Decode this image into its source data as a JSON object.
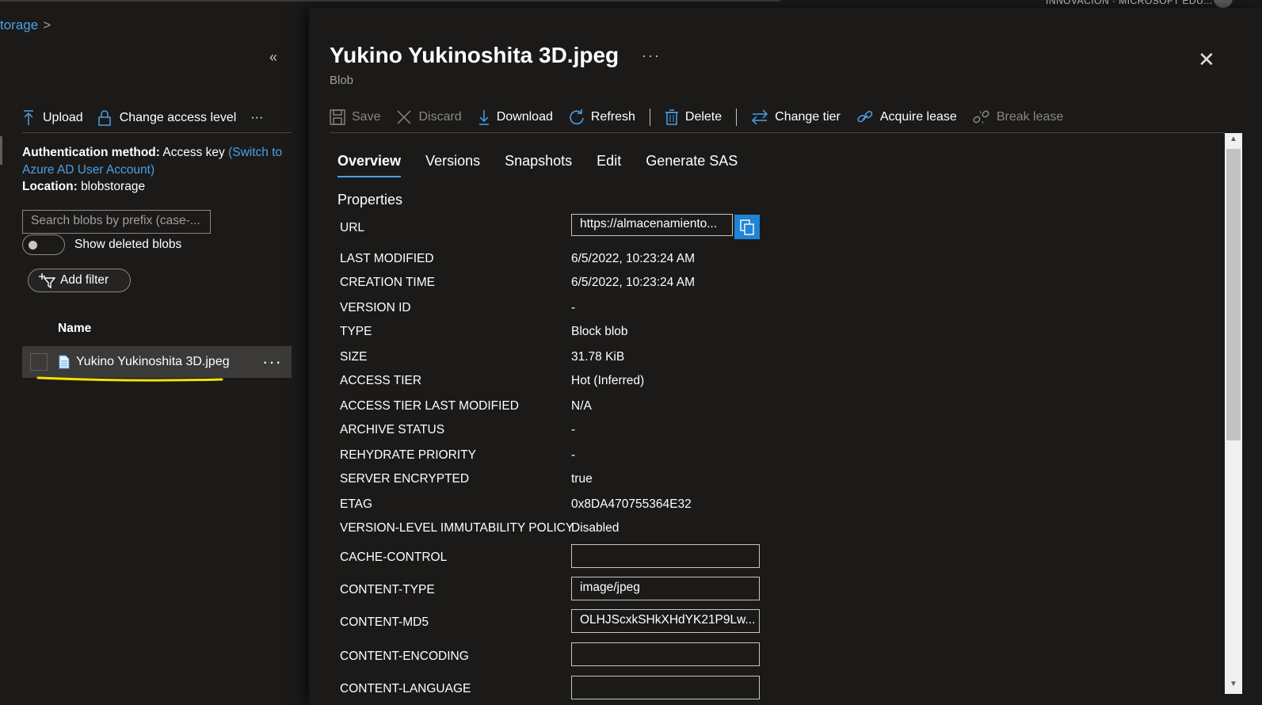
{
  "topbar": {
    "tenant": "INNOVACION · MICROSOFT EDU..."
  },
  "breadcrumb": {
    "item": "torage"
  },
  "left": {
    "toolbar": {
      "upload": "Upload",
      "change_access": "Change access level",
      "more": "···"
    },
    "auth": {
      "method_label": "Authentication method:",
      "method_value": "Access key",
      "switch_link": "(Switch to Azure AD User Account)",
      "location_label": "Location:",
      "location_value": "blobstorage"
    },
    "search_placeholder": "Search blobs by prefix (case-...",
    "show_deleted": "Show deleted blobs",
    "add_filter": "Add filter",
    "name_header": "Name",
    "file": {
      "name": "Yukino Yukinoshita 3D.jpeg",
      "more": "···"
    }
  },
  "blob": {
    "title": "Yukino Yukinoshita 3D.jpeg",
    "more": "···",
    "subtitle": "Blob",
    "toolbar": {
      "save": "Save",
      "discard": "Discard",
      "download": "Download",
      "refresh": "Refresh",
      "delete": "Delete",
      "change_tier": "Change tier",
      "acquire_lease": "Acquire lease",
      "break_lease": "Break lease"
    },
    "tabs": [
      "Overview",
      "Versions",
      "Snapshots",
      "Edit",
      "Generate SAS"
    ],
    "section": "Properties",
    "url": {
      "label": "URL",
      "value": "https://almacenamiento..."
    },
    "props": [
      {
        "label": "LAST MODIFIED",
        "value": "6/5/2022, 10:23:24 AM"
      },
      {
        "label": "CREATION TIME",
        "value": "6/5/2022, 10:23:24 AM"
      },
      {
        "label": "VERSION ID",
        "value": "-"
      },
      {
        "label": "TYPE",
        "value": "Block blob"
      },
      {
        "label": "SIZE",
        "value": "31.78 KiB"
      },
      {
        "label": "ACCESS TIER",
        "value": "Hot (Inferred)"
      },
      {
        "label": "ACCESS TIER LAST MODIFIED",
        "value": "N/A"
      },
      {
        "label": "ARCHIVE STATUS",
        "value": "-"
      },
      {
        "label": "REHYDRATE PRIORITY",
        "value": "-"
      },
      {
        "label": "SERVER ENCRYPTED",
        "value": "true"
      },
      {
        "label": "ETAG",
        "value": "0x8DA470755364E32"
      },
      {
        "label": "VERSION-LEVEL IMMUTABILITY POLICY",
        "value": "Disabled"
      }
    ],
    "fields": [
      {
        "label": "CACHE-CONTROL",
        "value": ""
      },
      {
        "label": "CONTENT-TYPE",
        "value": "image/jpeg"
      },
      {
        "label": "CONTENT-MD5",
        "value": "OLHJScxkSHkXHdYK21P9Lw..."
      },
      {
        "label": "CONTENT-ENCODING",
        "value": ""
      },
      {
        "label": "CONTENT-LANGUAGE",
        "value": ""
      }
    ]
  },
  "colors": {
    "accent": "#4aa0e6",
    "background": "#1b1a19",
    "highlight": "#f5e200"
  }
}
